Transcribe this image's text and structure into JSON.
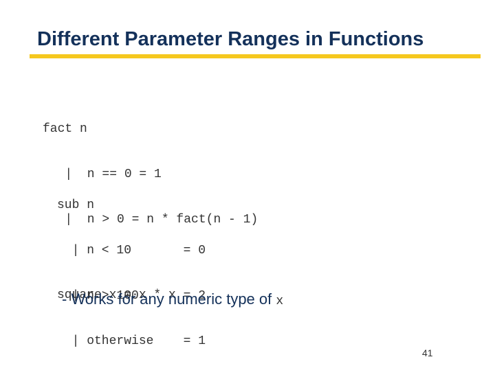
{
  "slide": {
    "title": "Different Parameter Ranges in Functions",
    "accent_color": "#f5c81e",
    "title_color": "#14315a",
    "code_blocks": {
      "fact": [
        "fact n",
        "   |  n == 0 = 1",
        "   |  n > 0 = n * fact(n - 1)"
      ],
      "sub": [
        "sub n",
        "  | n < 10       = 0",
        "  | n > 100      = 2",
        "  | otherwise    = 1"
      ],
      "square": [
        "square x = x * x"
      ]
    },
    "bullet": {
      "text": "- Works for any numeric type of ",
      "code": "x"
    },
    "page_number": "41"
  }
}
